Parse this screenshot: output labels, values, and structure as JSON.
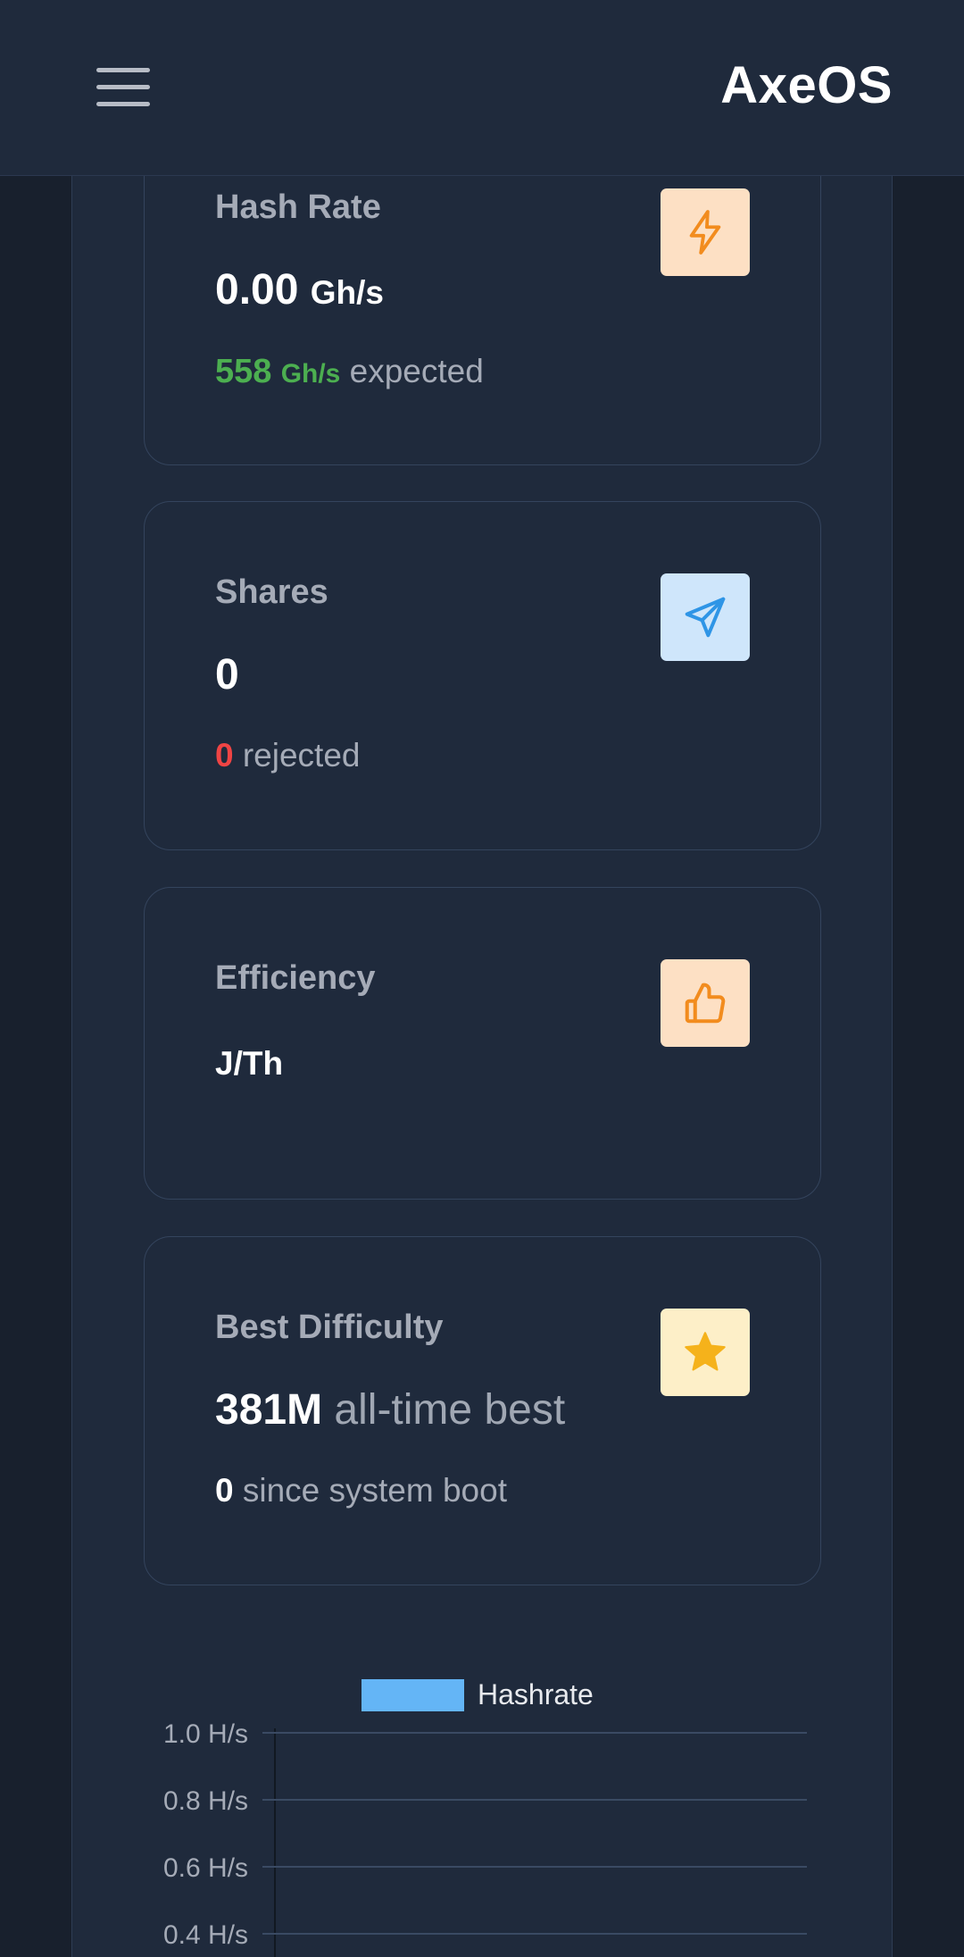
{
  "header": {
    "app_title": "AxeOS"
  },
  "cards": {
    "hash_rate": {
      "label": "Hash Rate",
      "value": "0.00",
      "unit": "Gh/s",
      "expected_value": "558",
      "expected_unit": "Gh/s",
      "expected_suffix": "expected",
      "icon": "lightning-icon"
    },
    "shares": {
      "label": "Shares",
      "value": "0",
      "rejected_value": "0",
      "rejected_suffix": "rejected",
      "icon": "send-icon"
    },
    "efficiency": {
      "label": "Efficiency",
      "value": "",
      "unit": "J/Th",
      "icon": "thumbs-up-icon"
    },
    "best_difficulty": {
      "label": "Best Difficulty",
      "value": "381M",
      "value_suffix": "all-time best",
      "since_boot_value": "0",
      "since_boot_suffix": "since system boot",
      "icon": "star-icon"
    }
  },
  "colors": {
    "background": "#18202d",
    "panel": "#1f2a3c",
    "accent_green": "#4caf50",
    "accent_red": "#ef4444",
    "accent_orange": "#f28c1e",
    "accent_blue": "#2f95e6",
    "accent_yellow": "#f5b21b",
    "series_color": "#64b5f6"
  },
  "chart_data": {
    "type": "line",
    "series": [
      {
        "name": "Hashrate",
        "values": []
      }
    ],
    "y_ticks": [
      "1.0 H/s",
      "0.8 H/s",
      "0.6 H/s",
      "0.4 H/s"
    ],
    "ylim": [
      0,
      1.0
    ],
    "grid": true,
    "legend": "top-center"
  }
}
